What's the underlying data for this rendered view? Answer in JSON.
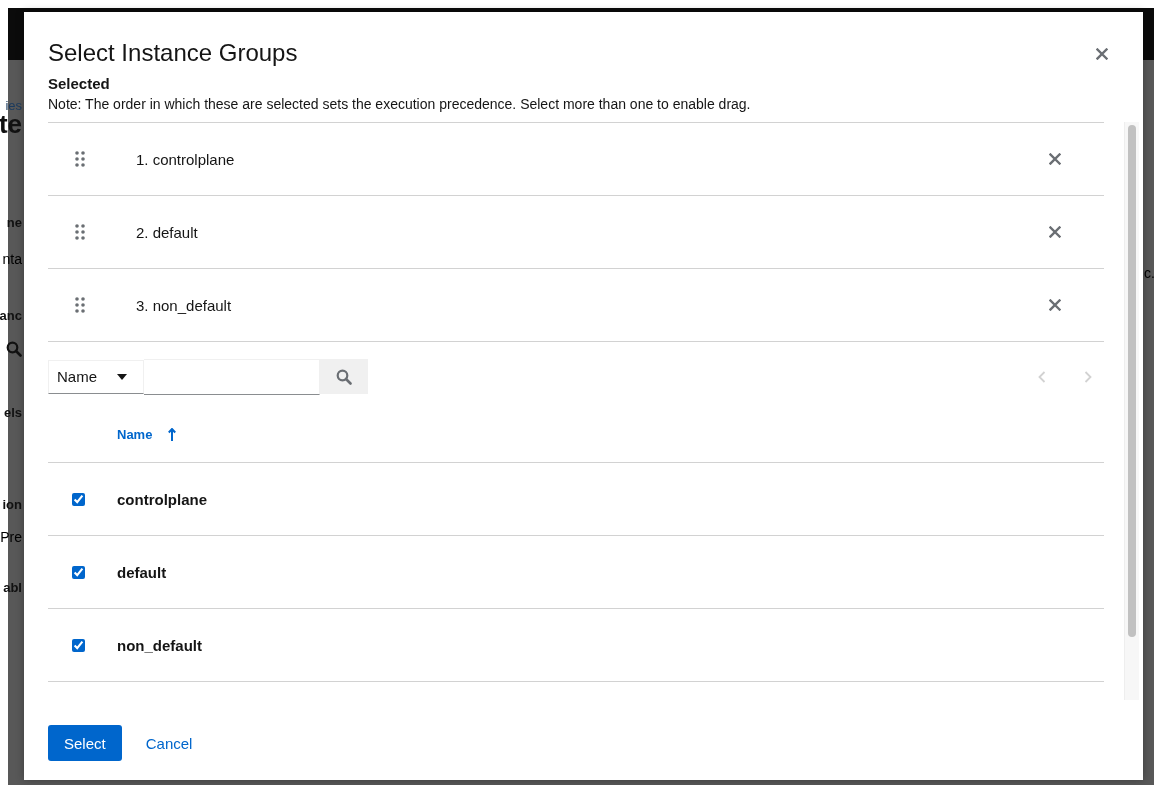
{
  "background": {
    "left_fragments": [
      {
        "kind": "link",
        "text": "ies"
      },
      {
        "kind": "heading",
        "text": "te"
      },
      {
        "kind": "label",
        "text": "ne"
      },
      {
        "kind": "value",
        "text": "nta"
      },
      {
        "kind": "label",
        "text": "anc"
      },
      {
        "kind": "search"
      },
      {
        "kind": "label",
        "text": "els"
      },
      {
        "kind": "label",
        "text": "ion"
      },
      {
        "kind": "value",
        "text": "Pre"
      },
      {
        "kind": "label",
        "text": "abl"
      }
    ],
    "right_fragments": [
      {
        "kind": "value",
        "text": "c."
      }
    ]
  },
  "modal": {
    "title": "Select Instance Groups",
    "selected_heading": "Selected",
    "note": "Note: The order in which these are selected sets the execution precedence. Select more than one to enable drag.",
    "selected_items": [
      {
        "label": "1. controlplane"
      },
      {
        "label": "2. default"
      },
      {
        "label": "3. non_default"
      }
    ],
    "filter": {
      "field": "Name"
    },
    "pagination": {
      "previous_disabled": true,
      "next_disabled": true
    },
    "table": {
      "columns": [
        {
          "label": "Name",
          "sorted": true
        }
      ],
      "rows": [
        {
          "name": "controlplane",
          "checked": true
        },
        {
          "name": "default",
          "checked": true
        },
        {
          "name": "non_default",
          "checked": true
        }
      ]
    },
    "buttons": [
      {
        "kind": "primary",
        "label": "Select"
      },
      {
        "kind": "link",
        "label": "Cancel"
      }
    ]
  }
}
